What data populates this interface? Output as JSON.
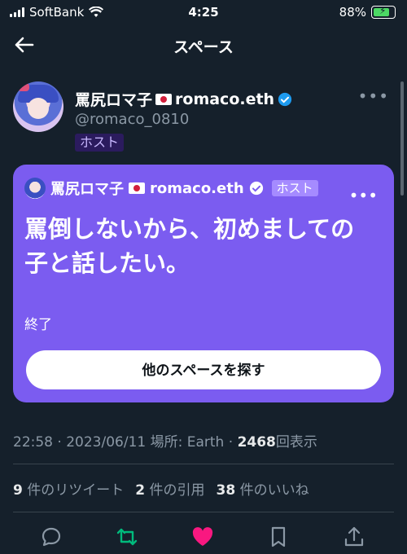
{
  "status_bar": {
    "carrier": "SoftBank",
    "time": "4:25",
    "battery_percent": "88%",
    "battery_level": 0.88
  },
  "header": {
    "title": "スペース"
  },
  "author": {
    "display_name": "罵尻ロマ子",
    "name_suffix": "romaco.eth",
    "handle": "@romaco_0810",
    "role_badge": "ホスト"
  },
  "space_card": {
    "host_name": "罵尻ロマ子",
    "host_suffix": "romaco.eth",
    "host_badge": "ホスト",
    "title": "罵倒しないから、初めましての子と話したい。",
    "status": "終了",
    "button_label": "他のスペースを探す",
    "background_color": "#7b5cf0"
  },
  "meta": {
    "time": "22:58",
    "date": "2023/06/11",
    "location": "場所: Earth",
    "views_count": "2468",
    "views_label": "回表示"
  },
  "stats": {
    "retweets_count": "9",
    "retweets_label": "件のリツイート",
    "quotes_count": "2",
    "quotes_label": "件の引用",
    "likes_count": "38",
    "likes_label": "件のいいね"
  },
  "icons": {
    "reply": "reply-icon",
    "retweet": "retweet-icon",
    "like": "heart-icon",
    "bookmark": "bookmark-icon",
    "share": "share-icon"
  },
  "colors": {
    "background": "#15202b",
    "retweet_active": "#00ba7c",
    "like_active": "#f91880",
    "verified": "#1d9bf0"
  }
}
